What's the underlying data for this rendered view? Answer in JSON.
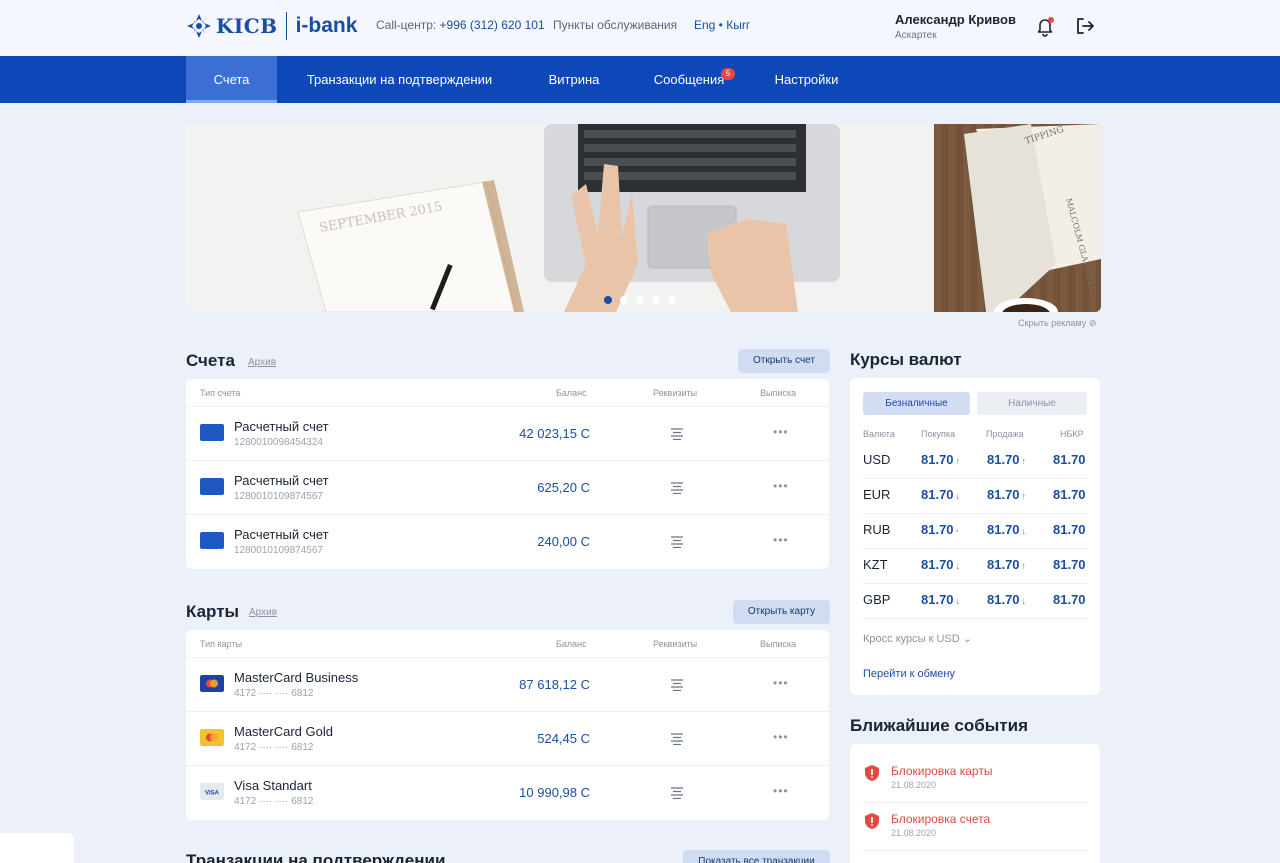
{
  "header": {
    "logo_text": "KICB",
    "logo_product": "i-bank",
    "callcenter_label": "Call-центр: ",
    "callcenter_number": "+996 (312) 620 101",
    "service_points": "Пункты обслуживания",
    "lang": "Eng • Кыrг",
    "user_name": "Александр Кривов",
    "user_sub": "Аскартек"
  },
  "nav": {
    "items": [
      {
        "label": "Счета"
      },
      {
        "label": "Транзакции на подтверждении"
      },
      {
        "label": "Витрина"
      },
      {
        "label": "Сообщения",
        "badge": "5"
      },
      {
        "label": "Настройки"
      }
    ]
  },
  "banner": {
    "calendar_text": "SEPTEMBER 2015",
    "book_text": "TIPPING MALCOLM GLADWELL",
    "slides": 5,
    "active_slide": 1,
    "hide_ad": "Скрыть рекламу"
  },
  "accounts": {
    "title": "Счета",
    "archive": "Архив",
    "button": "Открыть счет",
    "columns": [
      "Тип счета",
      "Баланс",
      "Реквизиты",
      "Выписка"
    ],
    "rows": [
      {
        "title": "Расчетный счет",
        "number": "1280010098454324",
        "balance": "42 023,15 С"
      },
      {
        "title": "Расчетный счет",
        "number": "1280010109874567",
        "balance": "625,20 С"
      },
      {
        "title": "Расчетный счет",
        "number": "1280010109874567",
        "balance": "240,00 С"
      }
    ],
    "more": "•••"
  },
  "cards": {
    "title": "Карты",
    "archive": "Архив",
    "button": "Открыть карту",
    "columns": [
      "Тип карты",
      "Баланс",
      "Реквизиты",
      "Выписка"
    ],
    "rows": [
      {
        "title": "MasterCard Business",
        "number": "4172 ···· ···· 6812",
        "balance": "87 618,12 С",
        "icon": "mastercard-blue-icon"
      },
      {
        "title": "MasterCard Gold",
        "number": "4172 ···· ···· 6812",
        "balance": "524,45 С",
        "icon": "mastercard-gold-icon"
      },
      {
        "title": "Visa Standart",
        "number": "4172 ···· ···· 6812",
        "balance": "10 990,98 С",
        "icon": "visa-icon"
      }
    ],
    "more": "•••"
  },
  "transactions": {
    "title": "Транзакции на подтверждении",
    "button": "Показать все транзакции"
  },
  "rates": {
    "title": "Курсы валют",
    "tabs": [
      "Безналичные",
      "Наличные"
    ],
    "columns": [
      "Валюта",
      "Покупка",
      "Продажа",
      "НБКР"
    ],
    "rows": [
      {
        "cur": "USD",
        "buy": "81.70",
        "buy_dir": "up",
        "sell": "81.70",
        "sell_dir": "up",
        "nbkr": "81.70"
      },
      {
        "cur": "EUR",
        "buy": "81.70",
        "buy_dir": "down",
        "sell": "81.70",
        "sell_dir": "up",
        "nbkr": "81.70"
      },
      {
        "cur": "RUB",
        "buy": "81.70",
        "buy_dir": "neutral",
        "sell": "81.70",
        "sell_dir": "down",
        "nbkr": "81.70"
      },
      {
        "cur": "KZT",
        "buy": "81.70",
        "buy_dir": "down",
        "sell": "81.70",
        "sell_dir": "up",
        "nbkr": "81.70"
      },
      {
        "cur": "GBP",
        "buy": "81.70",
        "buy_dir": "down",
        "sell": "81.70",
        "sell_dir": "down",
        "nbkr": "81.70"
      }
    ],
    "cross": "Кросс курсы к USD",
    "exchange": "Перейти к обмену"
  },
  "events": {
    "title": "Ближайшие события",
    "items": [
      {
        "title": "Блокировка карты",
        "date": "21.08.2020"
      },
      {
        "title": "Блокировка счета",
        "date": "21.08.2020"
      }
    ]
  },
  "colors": {
    "brand": "#0d47b8",
    "link": "#1a4ea3",
    "alert": "#e24a3f",
    "up": "#2aa54d"
  }
}
